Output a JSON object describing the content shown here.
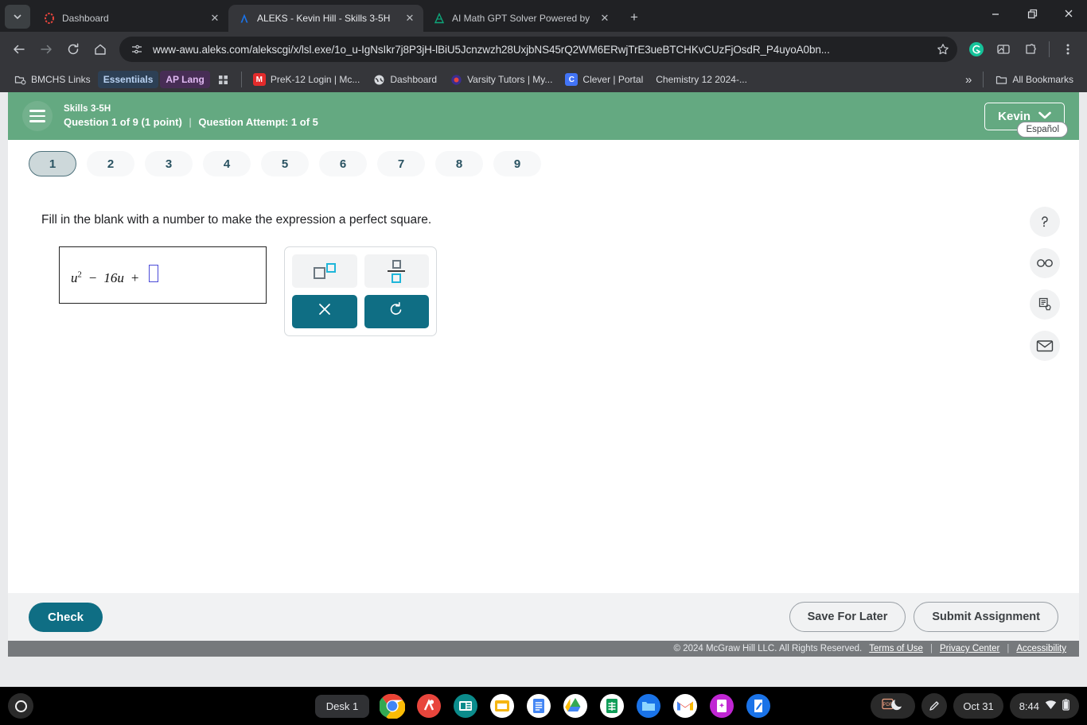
{
  "browser": {
    "tabs": [
      {
        "title": "Dashboard",
        "icon": "aleks-red-icon",
        "active": false
      },
      {
        "title": "ALEKS - Kevin Hill - Skills 3-5H",
        "icon": "aleks-blue-icon",
        "active": true
      },
      {
        "title": "AI Math GPT Solver Powered by",
        "icon": "math-gpt-icon",
        "active": false
      }
    ],
    "new_tab_label": "+",
    "window_controls": {
      "minimize": "–",
      "maximize": "❐",
      "close": "✕"
    },
    "nav": {
      "back": "←",
      "forward": "→",
      "reload": "↻",
      "home": "⌂"
    },
    "omnibox": {
      "url": "www-awu.aleks.com/alekscgi/x/lsl.exe/1o_u-IgNsIkr7j8P3jH-lBiU5Jcnzwzh28UxjbNS45rQ2WM6ERwjTrE3ueBTCHKvCUzFjOsdR_P4uyoA0bn...",
      "site_info_icon": "site-settings-icon",
      "bookmark_icon": "star-icon"
    },
    "toolbar_icons": [
      "grammarly-icon",
      "extension-split-icon",
      "extensions-puzzle-icon",
      "chrome-menu-icon"
    ],
    "bookmarks": [
      {
        "label": "BMCHS Links",
        "icon": "folder-settings-icon",
        "style": "plain"
      },
      {
        "label": "Essentiials",
        "icon": "",
        "style": "pill-blue"
      },
      {
        "label": "AP Lang",
        "icon": "",
        "style": "pill-purple"
      },
      {
        "label": "",
        "icon": "apps-grid-icon",
        "style": "icon-only"
      },
      {
        "label": "PreK-12 Login | Mc...",
        "icon": "mcgraw-m-icon",
        "style": "plain"
      },
      {
        "label": "Dashboard",
        "icon": "globe-icon",
        "style": "plain"
      },
      {
        "label": "Varsity Tutors | My...",
        "icon": "varsity-icon",
        "style": "plain"
      },
      {
        "label": "Clever | Portal",
        "icon": "clever-c-icon",
        "style": "plain"
      },
      {
        "label": "Chemistry 12 2024-...",
        "icon": "",
        "style": "plain"
      }
    ],
    "bookmarks_overflow": "»",
    "all_bookmarks_label": "All Bookmarks",
    "all_bookmarks_icon": "folder-icon"
  },
  "aleks": {
    "header": {
      "menu_icon": "hamburger-menu-icon",
      "skill_name": "Skills 3-5H",
      "question_label": "Question 1 of 9 (1 point)",
      "separator": "|",
      "attempt_label": "Question Attempt: 1 of 5",
      "user_name": "Kevin",
      "user_chevron_icon": "chevron-down-icon",
      "header_color": "#64a981"
    },
    "espanol_label": "Español",
    "question_pills": [
      "1",
      "2",
      "3",
      "4",
      "5",
      "6",
      "7",
      "8",
      "9"
    ],
    "current_pill": "1",
    "prompt": "Fill in the blank with a number to make the expression a perfect square.",
    "expression": {
      "variable": "u",
      "exponent": "2",
      "minus": "−",
      "term": "16u",
      "plus": "+",
      "answer_value": "",
      "answer_placeholder": ""
    },
    "palette": [
      {
        "name": "exponent-button",
        "glyph": "square-superscript",
        "style": "light"
      },
      {
        "name": "fraction-button",
        "glyph": "fraction",
        "style": "light"
      },
      {
        "name": "clear-button",
        "glyph": "✕",
        "style": "teal"
      },
      {
        "name": "undo-button",
        "glyph": "↺",
        "style": "teal"
      }
    ],
    "side_tools": [
      {
        "name": "help-icon",
        "glyph": "?"
      },
      {
        "name": "glasses-icon",
        "glyph": "∞"
      },
      {
        "name": "explanation-icon",
        "glyph": "☰"
      },
      {
        "name": "message-icon",
        "glyph": "✉"
      }
    ],
    "footer": {
      "check_label": "Check",
      "save_label": "Save For Later",
      "submit_label": "Submit Assignment",
      "accent_color": "#0f6e84"
    },
    "copyright": {
      "text": "© 2024 McGraw Hill LLC. All Rights Reserved.",
      "links": [
        "Terms of Use",
        "Privacy Center",
        "Accessibility"
      ],
      "separator": "|"
    }
  },
  "shelf": {
    "launcher_icon": "launcher-icon",
    "desk_label": "Desk 1",
    "apps": [
      {
        "name": "chrome-icon",
        "running": true
      },
      {
        "name": "aleks-red-icon",
        "running": false
      },
      {
        "name": "news-icon",
        "running": false
      },
      {
        "name": "slides-yellow-icon",
        "running": false
      },
      {
        "name": "docs-icon",
        "running": false
      },
      {
        "name": "drive-icon",
        "running": false
      },
      {
        "name": "sheets-icon",
        "running": false
      },
      {
        "name": "files-icon",
        "running": false
      },
      {
        "name": "gmail-icon",
        "running": false
      },
      {
        "name": "magic-icon",
        "running": false
      },
      {
        "name": "notes-icon",
        "running": false
      }
    ],
    "tray": {
      "pdf_icon": "pdf-icon",
      "moon_icon": "moon-icon",
      "stylus_icon": "stylus-icon",
      "date": "Oct 31",
      "time": "8:44",
      "wifi_icon": "wifi-icon",
      "battery_icon": "battery-icon"
    }
  }
}
